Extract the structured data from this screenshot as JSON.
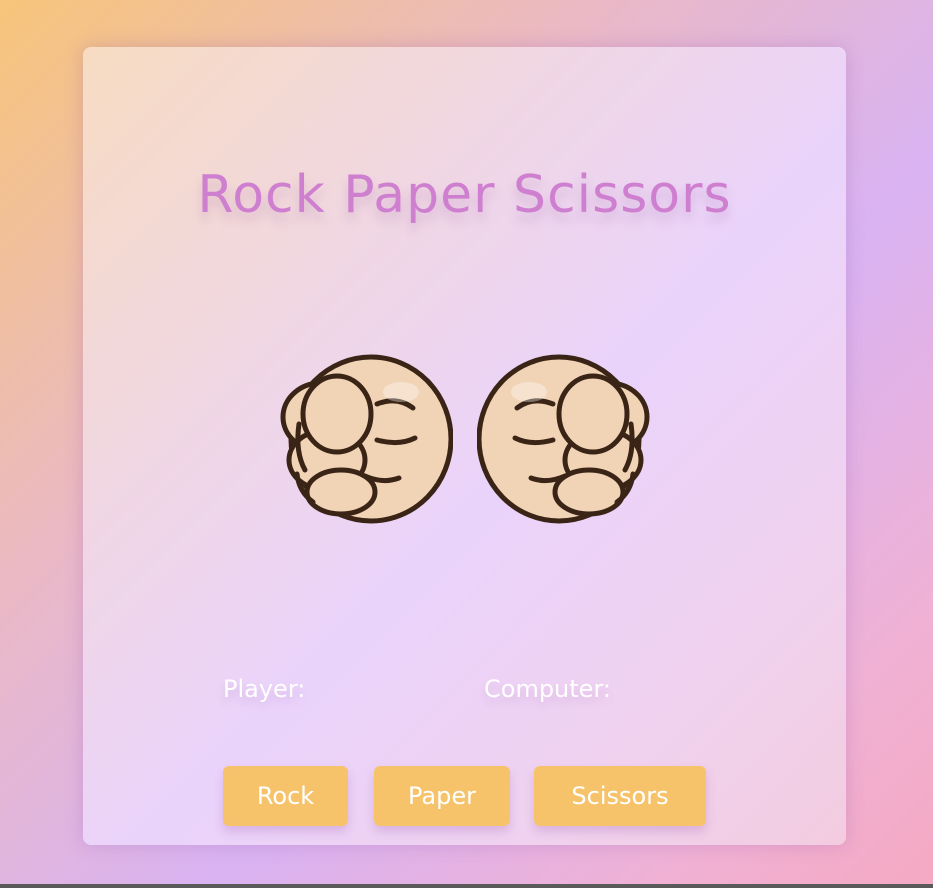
{
  "title": "Rock Paper Scissors",
  "hands": {
    "player": {
      "icon": "fist-icon"
    },
    "computer": {
      "icon": "fist-icon"
    }
  },
  "scores": {
    "player_label": "Player:",
    "computer_label": "Computer:"
  },
  "buttons": {
    "rock": "Rock",
    "paper": "Paper",
    "scissors": "Scissors"
  },
  "colors": {
    "title": "#cf7fcf",
    "button": "#f6c36a",
    "button_text": "#ffffff",
    "hand_skin": "#f1d3b6",
    "hand_outline": "#3a2416"
  }
}
